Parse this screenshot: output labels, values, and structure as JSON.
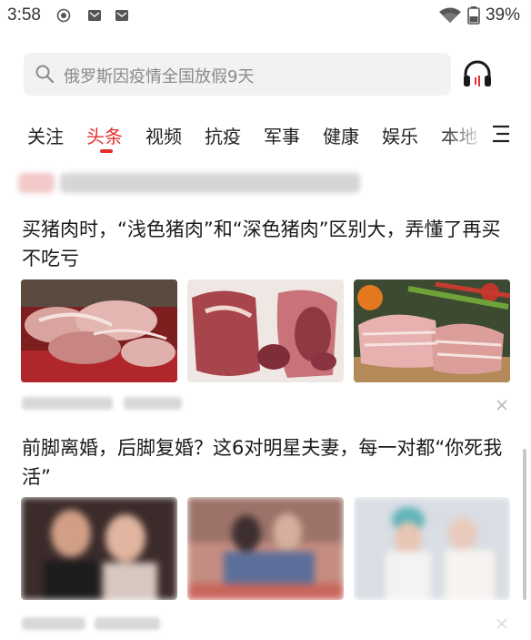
{
  "status_bar": {
    "time": "3:58",
    "battery": "39%",
    "left_icons": [
      "screen-record-icon",
      "mail-icon",
      "mail-icon"
    ],
    "right_icons": [
      "wifi-icon",
      "battery-icon"
    ]
  },
  "search": {
    "placeholder": "俄罗斯因疫情全国放假9天",
    "icon": "search-icon"
  },
  "header": {
    "audio_icon": "headphones-icon"
  },
  "tabs": [
    {
      "label": "关注",
      "active": false
    },
    {
      "label": "头条",
      "active": true
    },
    {
      "label": "视频",
      "active": false
    },
    {
      "label": "抗疫",
      "active": false
    },
    {
      "label": "军事",
      "active": false
    },
    {
      "label": "健康",
      "active": false
    },
    {
      "label": "娱乐",
      "active": false
    },
    {
      "label": "本地",
      "active": false
    }
  ],
  "colors": {
    "accent": "#e42f2f",
    "text": "#1a1a1a",
    "search_bg": "#f2f2f2"
  },
  "articles": [
    {
      "title": "买猪肉时，“浅色猪肉”和“深色猪肉”区别大，弄懂了再买不吃亏",
      "images": [
        "pork-carcasses-image",
        "pork-cuts-image",
        "pork-belly-image"
      ],
      "has_dismiss": true
    },
    {
      "title": "前脚离婚，后脚复婚？这6对明星夫妻，每一对都“你死我活”",
      "images": [
        "celebrity-couple-image",
        "dinner-photo-image",
        "wedding-photo-image"
      ],
      "has_dismiss": true
    }
  ]
}
